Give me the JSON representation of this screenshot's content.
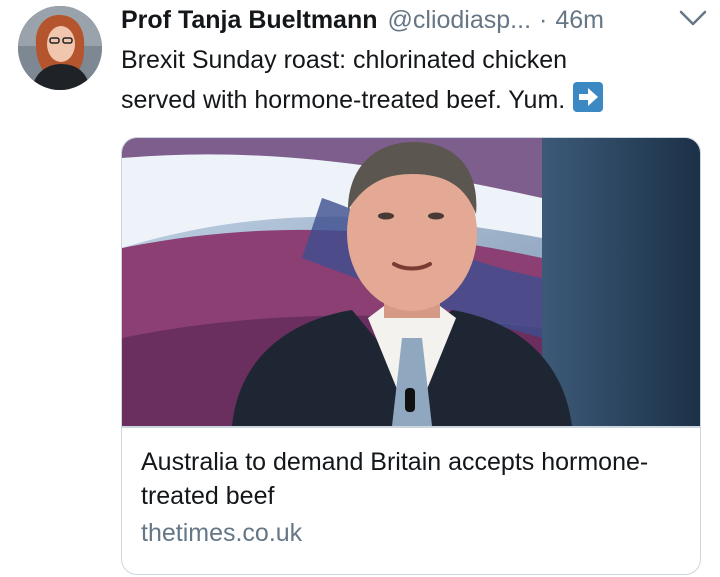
{
  "tweet": {
    "author": {
      "display_name": "Prof Tanja Bueltmann",
      "handle": "@cliodiasp...",
      "separator": "·",
      "timestamp": "46m",
      "avatar_icon": "profile-photo"
    },
    "menu_icon": "chevron-down-icon",
    "text_line1": "Brexit Sunday roast: chlorinated chicken",
    "text_line2": "served with hormone-treated beef. Yum.",
    "emoji": "right-arrow-emoji",
    "card": {
      "image_description_icon": "news-photo",
      "title": "Australia to demand Britain accepts hormone-treated beef",
      "domain": "thetimes.co.uk"
    },
    "colors": {
      "text": "#14171a",
      "secondary": "#657786",
      "border": "#ccd6dd",
      "emoji_blue": "#3b88c3"
    }
  }
}
